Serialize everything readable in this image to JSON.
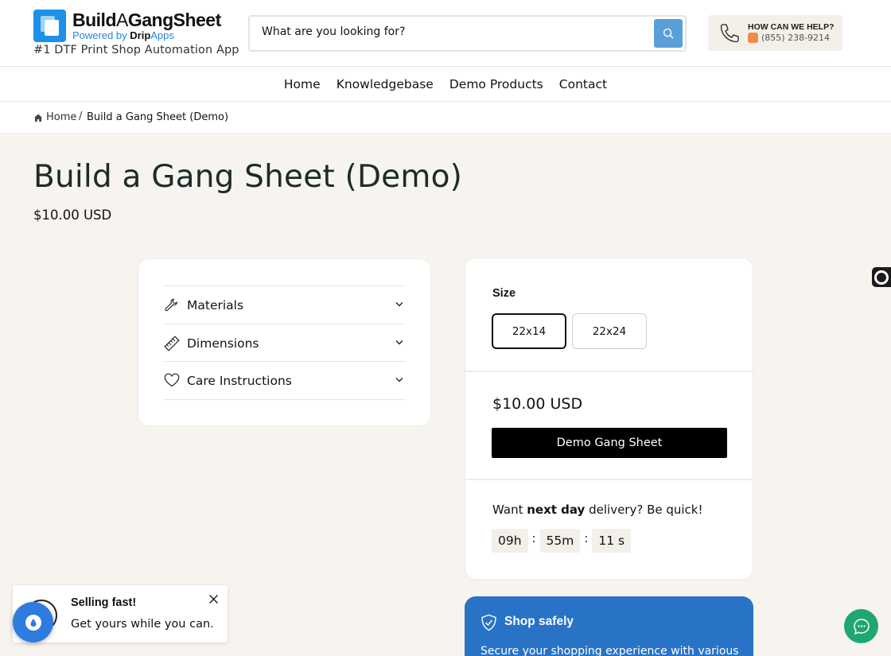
{
  "header": {
    "brand": {
      "build": "Build",
      "a": "A",
      "gang": "GangSheet"
    },
    "powered_by": {
      "prefix": "Powered by ",
      "drip": "Drip",
      "apps": "Apps"
    },
    "tagline": "#1 DTF Print Shop Automation App",
    "search": {
      "value": "What are you looking for?",
      "icon": "search-icon"
    },
    "help": {
      "title": "HOW CAN WE HELP?",
      "phone": "(855) 238-9214",
      "icon": "phone-icon"
    }
  },
  "nav": {
    "items": [
      {
        "label": "Home"
      },
      {
        "label": "Knowledgebase"
      },
      {
        "label": "Demo Products"
      },
      {
        "label": "Contact"
      }
    ]
  },
  "breadcrumb": {
    "home": "Home",
    "separator": "/",
    "current": "Build a Gang Sheet (Demo)"
  },
  "product": {
    "title": "Build a Gang Sheet (Demo)",
    "price": "$10.00 USD",
    "accordion": [
      {
        "label": "Materials",
        "icon": "wrench-icon"
      },
      {
        "label": "Dimensions",
        "icon": "ruler-icon"
      },
      {
        "label": "Care Instructions",
        "icon": "heart-icon"
      }
    ],
    "size": {
      "label": "Size",
      "options": [
        "22x14",
        "22x24"
      ],
      "selected": "22x14"
    },
    "buy_price": "$10.00 USD",
    "cta": "Demo Gang Sheet",
    "delivery": {
      "prefix": "Want ",
      "bold": "next day",
      "suffix": " delivery? Be quick!"
    },
    "timer": {
      "hours": "09h",
      "minutes": "55m",
      "seconds": "11 s",
      "separator": ":"
    }
  },
  "shop_safely": {
    "title": "Shop safely",
    "text": "Secure your shopping experience with various"
  },
  "toast": {
    "title": "Selling fast!",
    "text": "Get yours while you can."
  },
  "colors": {
    "accent_blue": "#2873c6",
    "chat_green": "#1fa772",
    "cta_black": "#000000",
    "page_bg": "#f7f4ef"
  }
}
